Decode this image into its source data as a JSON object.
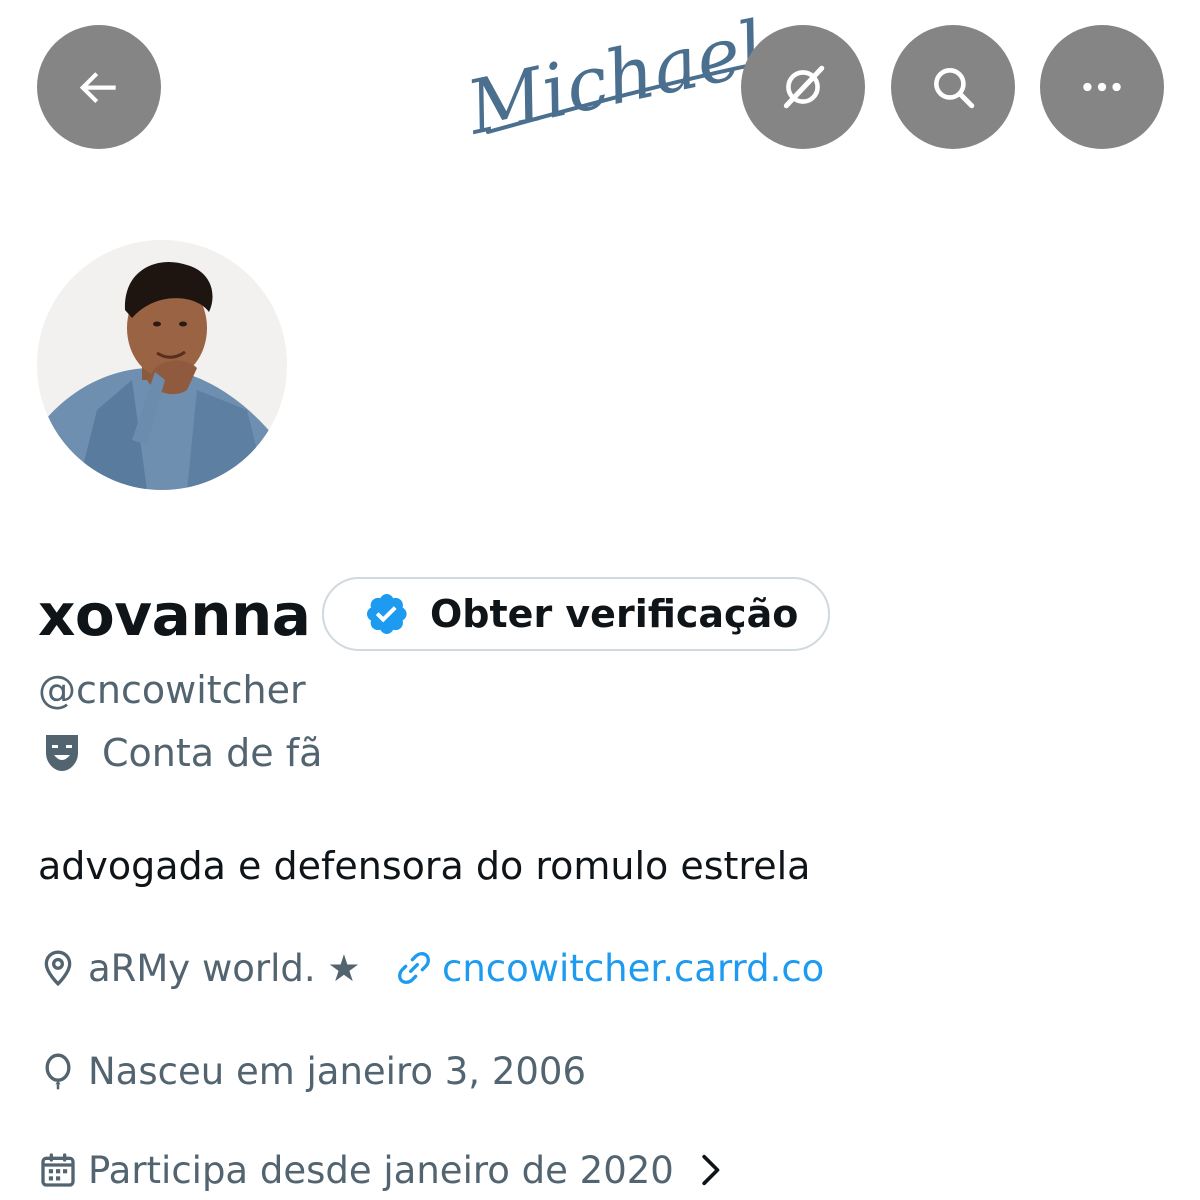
{
  "header": {
    "signature_text": "Michael",
    "buttons": {
      "back": "arrow-left-icon",
      "grok": "grok-icon",
      "search": "search-icon",
      "more": "more-horizontal-icon"
    },
    "button_color": "#858585"
  },
  "profile": {
    "display_name": "xovanna",
    "verify_button_label": "Obter verificação",
    "handle": "@cncowitcher",
    "account_label": "Conta de fã",
    "bio": "advogada e defensora do romulo estrela",
    "location": "aRMy world. ★",
    "website": "cncowitcher.carrd.co",
    "birth": "Nasceu em janeiro 3, 2006",
    "joined": "Participa desde janeiro de 2020"
  },
  "colors": {
    "text_primary": "#0f1419",
    "text_secondary": "#536471",
    "link": "#1d9bf0",
    "verified_badge": "#1d9bf0",
    "signature_ink": "#4a6f8f"
  }
}
